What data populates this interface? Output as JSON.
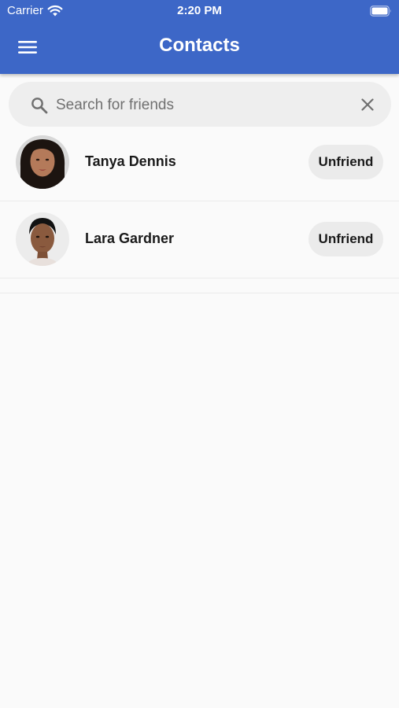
{
  "status_bar": {
    "carrier": "Carrier",
    "time": "2:20 PM",
    "icons": [
      "wifi-icon",
      "battery-icon"
    ]
  },
  "header": {
    "title": "Contacts",
    "menu_icon": "menu-icon",
    "background_color": "#3d67c7"
  },
  "search": {
    "placeholder": "Search for friends",
    "value": "",
    "search_icon": "search-icon",
    "clear_icon": "close-icon"
  },
  "contacts": [
    {
      "name": "Tanya Dennis",
      "action_label": "Unfriend"
    },
    {
      "name": "Lara Gardner",
      "action_label": "Unfriend"
    }
  ]
}
